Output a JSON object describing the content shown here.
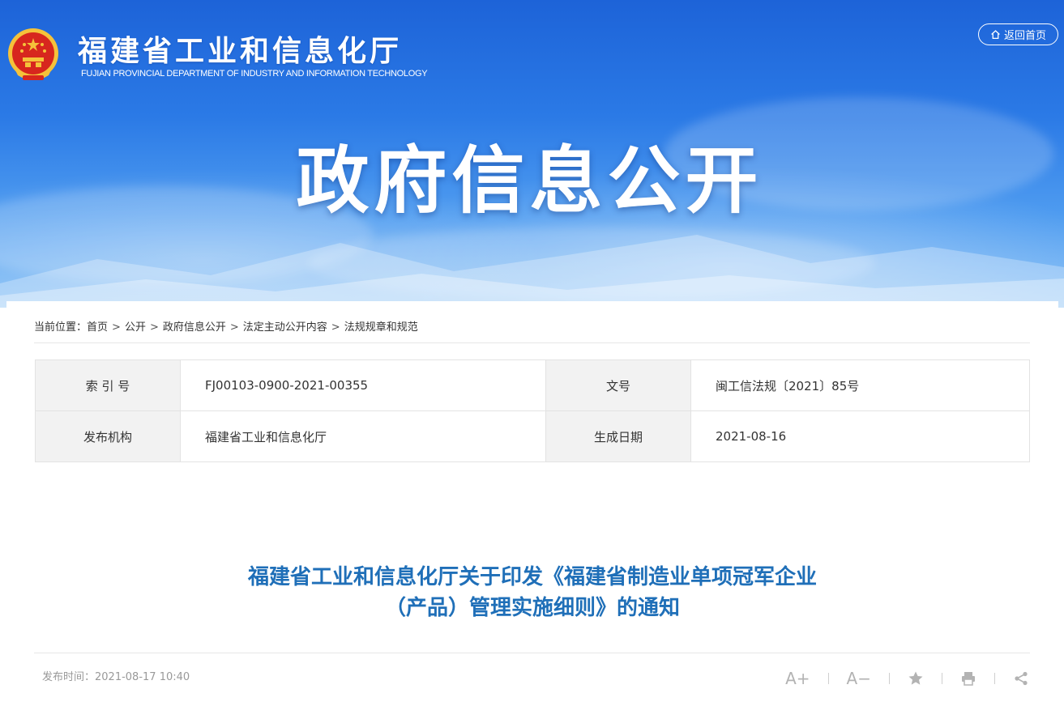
{
  "header": {
    "site_title": "福建省工业和信息化厅",
    "site_subtitle": "FUJIAN PROVINCIAL DEPARTMENT OF INDUSTRY AND INFORMATION TECHNOLOGY",
    "home_button_label": "返回首页",
    "home_icon": "home-icon",
    "emblem": "national-emblem"
  },
  "banner": {
    "heading": "政府信息公开"
  },
  "breadcrumb": {
    "prefix": "当前位置：",
    "items": [
      "首页",
      "公开",
      "政府信息公开",
      "法定主动公开内容",
      "法规规章和规范"
    ],
    "separator": ">"
  },
  "meta": {
    "index_label": "索 引 号",
    "index_value": "FJ00103-0900-2021-00355",
    "doc_no_label": "文号",
    "doc_no_value": "闽工信法规〔2021〕85号",
    "publisher_label": "发布机构",
    "publisher_value": "福建省工业和信息化厅",
    "date_label": "生成日期",
    "date_value": "2021-08-16"
  },
  "article": {
    "title_line1": "福建省工业和信息化厅关于印发《福建省制造业单项冠军企业",
    "title_line2": "（产品）管理实施细则》的通知",
    "publish_label": "发布时间：",
    "publish_time": "2021-08-17 10:40"
  },
  "tools": {
    "font_increase": "A+",
    "font_decrease": "A−",
    "icons": [
      "font-increase-icon",
      "font-decrease-icon",
      "star-icon",
      "print-icon",
      "share-icon"
    ]
  },
  "colors": {
    "banner_blue": "#2b7ae6",
    "title_blue": "#1f6fb8",
    "emblem_red": "#d7261e",
    "emblem_gold": "#f5c23a"
  }
}
